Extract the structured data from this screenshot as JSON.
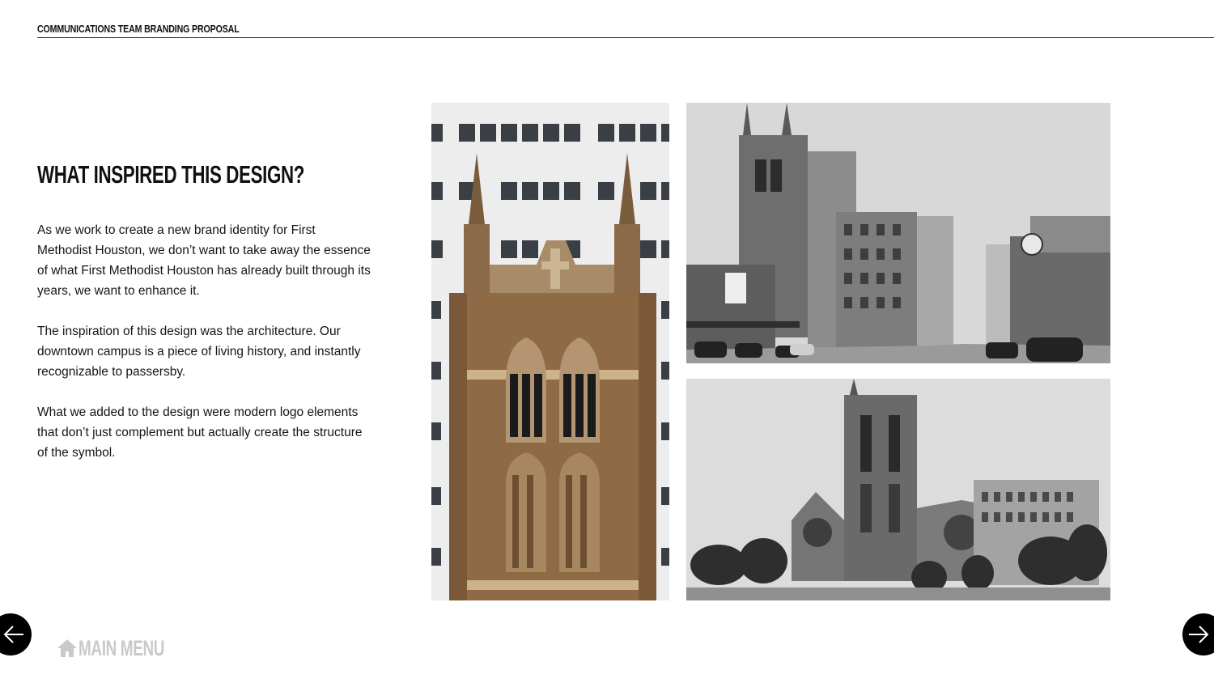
{
  "header": {
    "title": "COMMUNICATIONS TEAM BRANDING PROPOSAL"
  },
  "section": {
    "heading": "WHAT INSPIRED THIS DESIGN?",
    "paragraphs": [
      "As we work to create a new brand identity for First Methodist Houston, we don’t want to take away the essence of what First Methodist Houston has already built through its years, we want to enhance it.",
      "The inspiration of this design was the architecture. Our downtown campus is a piece of living history, and instantly recognizable to passersby.",
      "What we added to the design were modern logo elements that don’t just complement but actually create the structure of the symbol."
    ]
  },
  "navigation": {
    "prev_icon": "arrow-left-icon",
    "next_icon": "arrow-right-icon",
    "main_menu_label": "MAIN MENU",
    "main_menu_icon": "home-icon"
  },
  "colors": {
    "nav_button": "#000000",
    "main_menu": "#c9c9c9",
    "text": "#111111"
  }
}
